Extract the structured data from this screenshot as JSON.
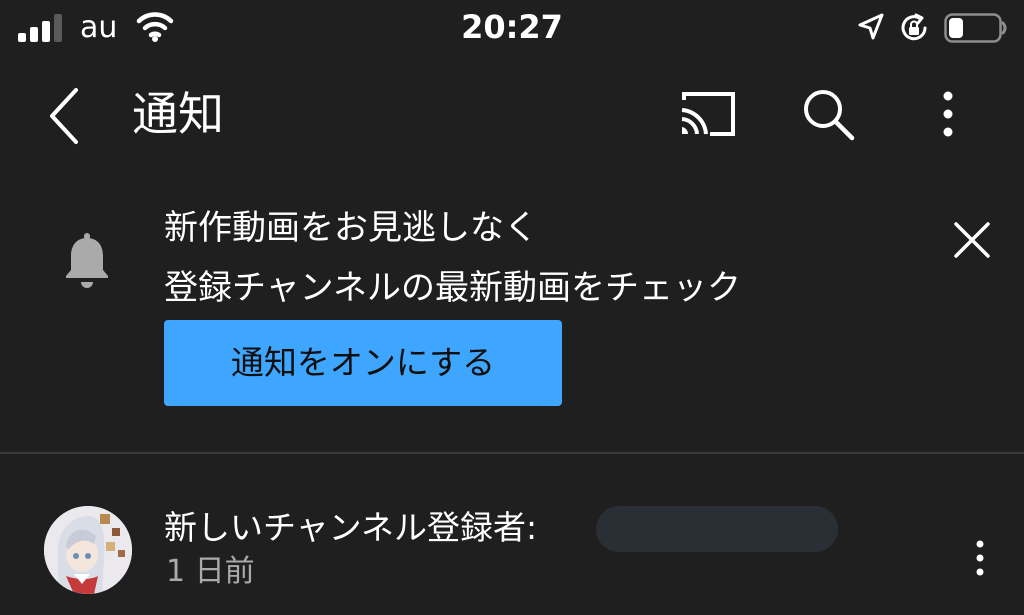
{
  "status_bar": {
    "carrier": "au",
    "time": "20:27"
  },
  "app_bar": {
    "title": "通知",
    "icons": [
      "back-icon",
      "cast-icon",
      "search-icon",
      "more-vert-icon"
    ]
  },
  "promo": {
    "line1": "新作動画をお見逃しなく",
    "line2": "登録チャンネルの最新動画をチェック",
    "button_label": "通知をオンにする",
    "accent_color": "#3ea6ff"
  },
  "notification": {
    "message": "新しいチャンネル登録者:",
    "time": "1 日前"
  },
  "colors": {
    "background": "#1f1f1f",
    "text": "#ffffff",
    "secondary_text": "#aaaaaa"
  }
}
